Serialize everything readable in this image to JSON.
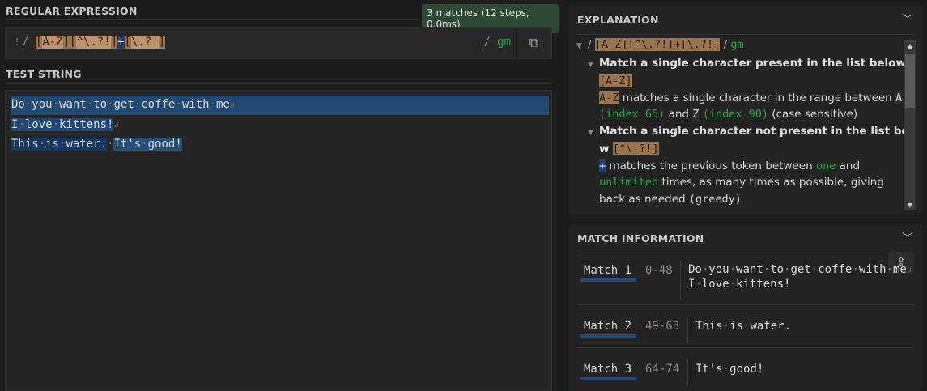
{
  "regex_section": {
    "title": "REGULAR EXPRESSION",
    "status": "3 matches (12 steps, 0.0ms)",
    "delimiter": "/",
    "tokens": {
      "open1": "[",
      "range": "A-Z",
      "close1": "]",
      "open2": "[",
      "neg": "^\\.?!",
      "close2": "]",
      "quant": "+",
      "open3": "[",
      "chars": "\\.?!",
      "close3": "]"
    },
    "flags": "gm"
  },
  "test_string": {
    "title": "TEST STRING",
    "lines": [
      "Do you want to get coffe with me",
      "I love kittens!",
      "This is water.",
      "It's good!"
    ]
  },
  "explanation": {
    "title": "EXPLANATION",
    "regex_full": "[A-Z][^\\.?!]+[\\.?!]",
    "flags": "gm",
    "item1_title": "Match a single character present in the list below",
    "item1_token": "[A-Z]",
    "item1_range": "A-Z",
    "item1_text1": "matches a single character in the range between",
    "item1_a": "A",
    "item1_idx65": "(index 65)",
    "item1_and": "and",
    "item1_z": "Z",
    "item1_idx90": "(index 90)",
    "item1_case": "(case sensitive)",
    "item2_title": "Match a single character not present in the list belo",
    "item2_title_wrap": "w",
    "item2_token": "[^\\.?!]",
    "item2_plus": "+",
    "item2_text1": "matches the previous token between",
    "item2_one": "one",
    "item2_and": "and",
    "item2_unlimited": "unlimited",
    "item2_text2": "times, as many times as possible, giving",
    "item2_text3": "back as needed",
    "item2_greedy": "(greedy)"
  },
  "match_info": {
    "title": "MATCH INFORMATION",
    "matches": [
      {
        "label": "Match 1",
        "range": "0-48",
        "line1": "Do you want to get coffe with me",
        "line2": "I love kittens!"
      },
      {
        "label": "Match 2",
        "range": "49-63",
        "line1": "This is water."
      },
      {
        "label": "Match 3",
        "range": "64-74",
        "line1": "It's good!"
      }
    ]
  },
  "colors": {
    "match_a": "#204a72",
    "match_b": "#123963",
    "token_class": "#9c744c",
    "quantifier": "#1e3f7c",
    "flag_green": "#2fa24d"
  }
}
